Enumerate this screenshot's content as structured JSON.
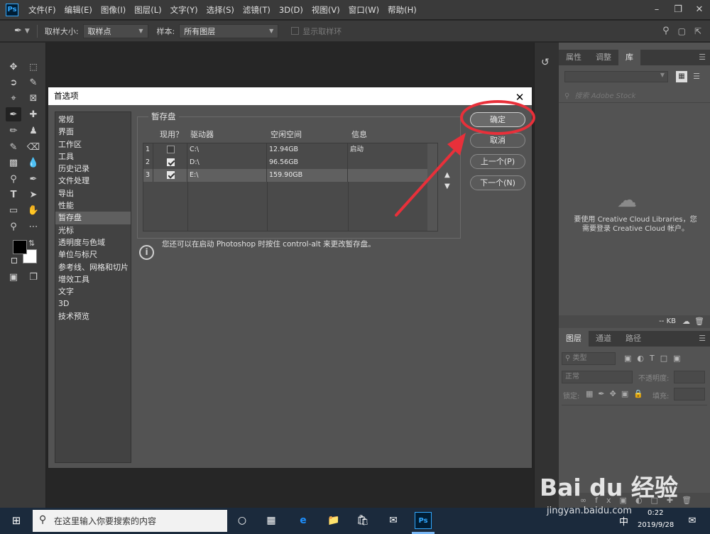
{
  "menubar": {
    "logo": "Ps",
    "items": [
      "文件(F)",
      "编辑(E)",
      "图像(I)",
      "图层(L)",
      "文字(Y)",
      "选择(S)",
      "滤镜(T)",
      "3D(D)",
      "视图(V)",
      "窗口(W)",
      "帮助(H)"
    ]
  },
  "optionsbar": {
    "sample_size_label": "取样大小:",
    "sample_size_value": "取样点",
    "sample_label": "样本:",
    "sample_value": "所有图层",
    "show_ring_label": "显示取样环"
  },
  "dialog": {
    "title": "首选项",
    "categories": [
      "常规",
      "界面",
      "工作区",
      "工具",
      "历史记录",
      "文件处理",
      "导出",
      "性能",
      "暂存盘",
      "光标",
      "透明度与色域",
      "单位与标尺",
      "参考线、网格和切片",
      "增效工具",
      "文字",
      "3D",
      "技术预览"
    ],
    "active_category": "暂存盘",
    "group_title": "暂存盘",
    "columns": [
      "现用？",
      "驱动器",
      "空闲空间",
      "信息"
    ],
    "rows": [
      {
        "num": "1",
        "active": false,
        "drive": "C:\\",
        "free": "12.94GB",
        "info": "启动"
      },
      {
        "num": "2",
        "active": true,
        "drive": "D:\\",
        "free": "96.56GB",
        "info": ""
      },
      {
        "num": "3",
        "active": true,
        "drive": "E:\\",
        "free": "159.90GB",
        "info": ""
      }
    ],
    "buttons": {
      "ok": "确定",
      "cancel": "取消",
      "prev": "上一个(P)",
      "next": "下一个(N)"
    },
    "info_text": "您还可以在启动 Photoshop 时按住 control-alt 来更改暂存盘。"
  },
  "panels": {
    "top_tabs": [
      "属性",
      "调整",
      "库"
    ],
    "search_placeholder": "搜索 Adobe Stock",
    "cc_message": "要使用 Creative Cloud Libraries，您需要登录 Creative Cloud 帐户。",
    "kb_label": "-- KB",
    "bottom_tabs": [
      "图层",
      "通道",
      "路径"
    ],
    "layer_filter": "类型",
    "blend_mode": "正常",
    "opacity_label": "不透明度:",
    "lock_label": "锁定:",
    "fill_label": "填充:"
  },
  "taskbar": {
    "search_placeholder": "在这里输入你要搜索的内容",
    "ime": "中",
    "time": "0:22",
    "date": "2019/9/28"
  },
  "watermark": {
    "brand": "Bai du 经验",
    "url": "jingyan.baidu.com"
  },
  "colors": {
    "annotation_red": "#e8303a",
    "ps_blue": "#31a8ff"
  }
}
